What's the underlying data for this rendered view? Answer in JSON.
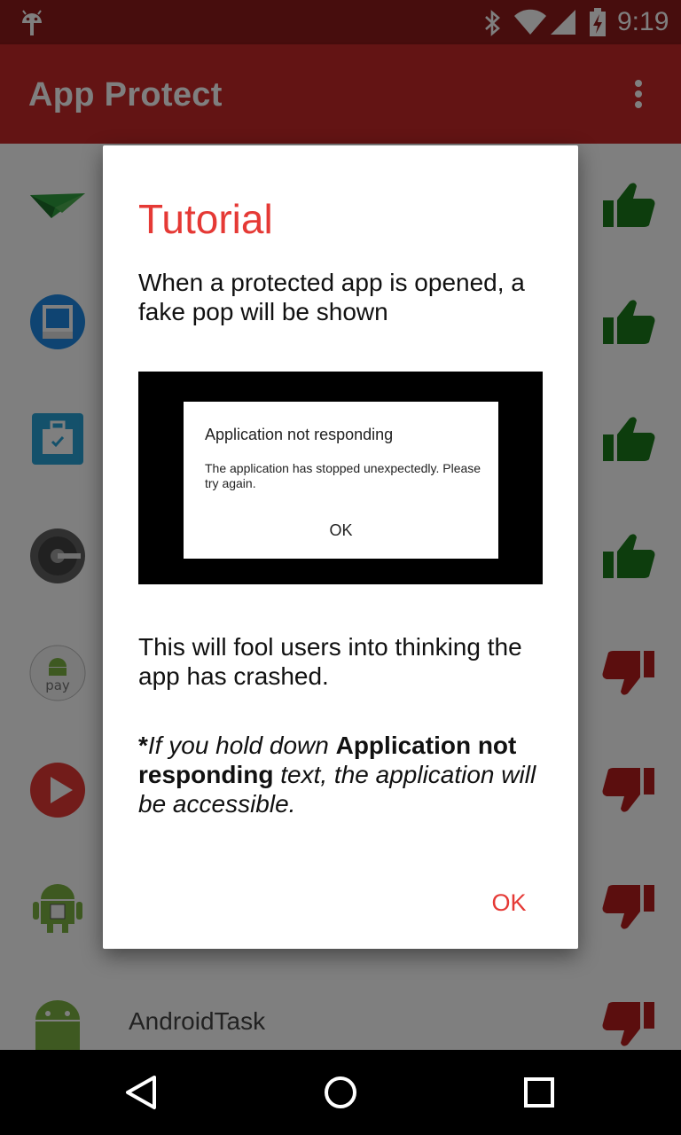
{
  "status_bar": {
    "time": "9:19",
    "icons": [
      "android-icon",
      "bluetooth-icon",
      "wifi-icon",
      "signal-icon",
      "battery-charging-icon"
    ]
  },
  "app_bar": {
    "title": "App Protect",
    "menu_icon": "more-vert-icon"
  },
  "app_list": [
    {
      "icon": "paper-plane-app-icon",
      "name": "",
      "status": "thumbs-up"
    },
    {
      "icon": "scanner-app-icon",
      "name": "",
      "status": "thumbs-up"
    },
    {
      "icon": "briefcase-app-icon",
      "name": "",
      "status": "thumbs-up"
    },
    {
      "icon": "safe-dial-app-icon",
      "name": "",
      "status": "thumbs-up"
    },
    {
      "icon": "android-pay-icon",
      "name": "",
      "status": "thumbs-down"
    },
    {
      "icon": "play-app-icon",
      "name": "",
      "status": "thumbs-down"
    },
    {
      "icon": "android-box-app-icon",
      "name": "",
      "status": "thumbs-down"
    },
    {
      "icon": "android-app-icon",
      "name": "AndroidTask",
      "status": "thumbs-down"
    }
  ],
  "android_pay_label": "pay",
  "dialog": {
    "title": "Tutorial",
    "intro": "When a protected app is opened, a fake pop will be shown",
    "fake_popup": {
      "title": "Application not responding",
      "message": "The application has stopped unexpectedly. Please try again.",
      "ok": "OK"
    },
    "explanation": "This will fool users into thinking the app has crashed.",
    "note_star": "*",
    "note_part1": "If you hold down ",
    "note_bold": "Application not responding",
    "note_part2": " text, the application will be accessible.",
    "ok_button": "OK"
  },
  "nav_bar": {
    "back": "back-icon",
    "home": "home-icon",
    "recents": "recents-icon"
  },
  "colors": {
    "status_bar": "#8e1a1a",
    "app_bar": "#c62828",
    "accent": "#e53935",
    "thumb_up": "#1b7a1b",
    "thumb_down": "#b71c1c"
  }
}
